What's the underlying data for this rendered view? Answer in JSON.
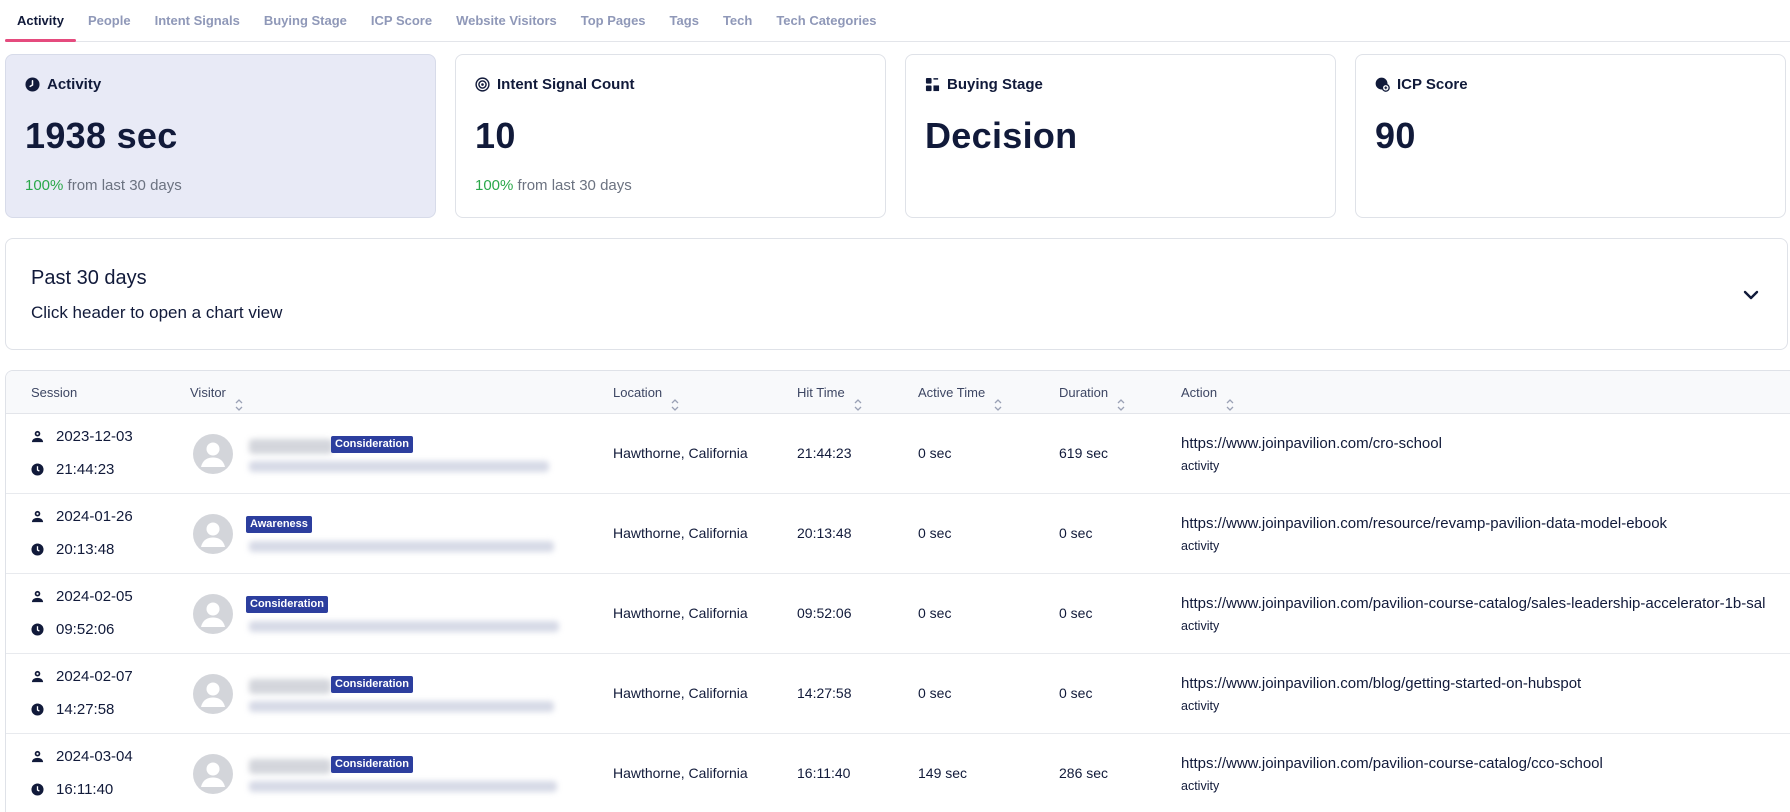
{
  "tabs": [
    {
      "label": "Activity",
      "active": true
    },
    {
      "label": "People"
    },
    {
      "label": "Intent Signals"
    },
    {
      "label": "Buying Stage"
    },
    {
      "label": "ICP Score"
    },
    {
      "label": "Website Visitors"
    },
    {
      "label": "Top Pages"
    },
    {
      "label": "Tags"
    },
    {
      "label": "Tech"
    },
    {
      "label": "Tech Categories"
    }
  ],
  "cards": [
    {
      "title": "Activity",
      "value": "1938 sec",
      "trend_pct": "100%",
      "trend_text": " from last 30 days",
      "icon": "clock-icon"
    },
    {
      "title": "Intent Signal Count",
      "value": "10",
      "trend_pct": "100%",
      "trend_text": " from last 30 days",
      "icon": "target-icon"
    },
    {
      "title": "Buying Stage",
      "value": "Decision",
      "icon": "stage-icon"
    },
    {
      "title": "ICP Score",
      "value": "90",
      "icon": "score-icon"
    }
  ],
  "period": {
    "title": "Past 30 days",
    "subtitle": "Click header to open a chart view",
    "icon": "chevron-down-icon"
  },
  "table": {
    "headers": {
      "session": "Session",
      "visitor": "Visitor",
      "location": "Location",
      "hit_time": "Hit Time",
      "active_time": "Active Time",
      "duration": "Duration",
      "action": "Action"
    },
    "rows": [
      {
        "date": "2023-12-03",
        "time": "21:44:23",
        "stage": "Consideration",
        "location": "Hawthorne, California",
        "hit_time": "21:44:23",
        "active_time": "0 sec",
        "duration": "619 sec",
        "url": "https://www.joinpavilion.com/cro-school",
        "action_type": "activity"
      },
      {
        "date": "2024-01-26",
        "time": "20:13:48",
        "stage": "Awareness",
        "location": "Hawthorne, California",
        "hit_time": "20:13:48",
        "active_time": "0 sec",
        "duration": "0 sec",
        "url": "https://www.joinpavilion.com/resource/revamp-pavilion-data-model-ebook",
        "action_type": "activity"
      },
      {
        "date": "2024-02-05",
        "time": "09:52:06",
        "stage": "Consideration",
        "location": "Hawthorne, California",
        "hit_time": "09:52:06",
        "active_time": "0 sec",
        "duration": "0 sec",
        "url": "https://www.joinpavilion.com/pavilion-course-catalog/sales-leadership-accelerator-1b-sal",
        "action_type": "activity"
      },
      {
        "date": "2024-02-07",
        "time": "14:27:58",
        "stage": "Consideration",
        "location": "Hawthorne, California",
        "hit_time": "14:27:58",
        "active_time": "0 sec",
        "duration": "0 sec",
        "url": "https://www.joinpavilion.com/blog/getting-started-on-hubspot",
        "action_type": "activity"
      },
      {
        "date": "2024-03-04",
        "time": "16:11:40",
        "stage": "Consideration",
        "location": "Hawthorne, California",
        "hit_time": "16:11:40",
        "active_time": "149 sec",
        "duration": "286 sec",
        "url": "https://www.joinpavilion.com/pavilion-course-catalog/cco-school",
        "action_type": "activity"
      }
    ]
  },
  "colors": {
    "accent_tab": "#e54b7e",
    "trend_positive": "#2aa84a",
    "badge_bg": "#2c3e9e",
    "highlight_card": "#e8eaf6"
  }
}
